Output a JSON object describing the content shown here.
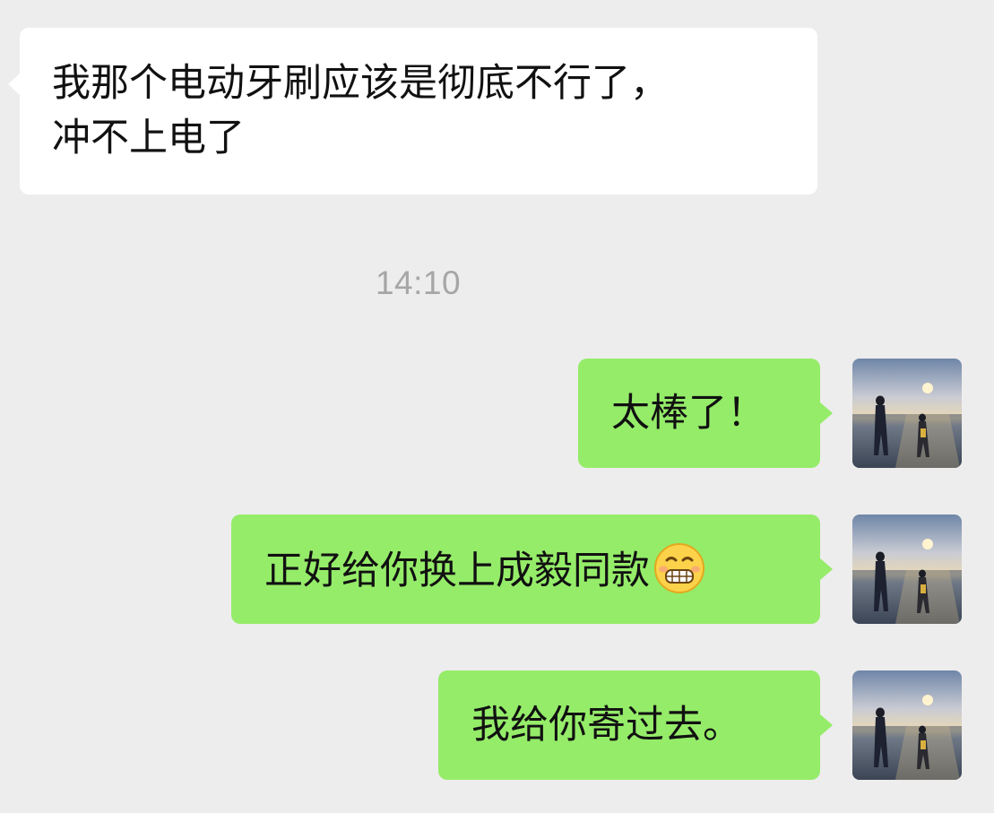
{
  "conversation": {
    "timestamp": "14:10",
    "messages": [
      {
        "direction": "incoming",
        "text": "我那个电动牙刷应该是彻底不行了，\n冲不上电了"
      },
      {
        "direction": "outgoing",
        "text": "太棒了！"
      },
      {
        "direction": "outgoing",
        "text": "正好给你换上成毅同款",
        "emoji": "grinning-face-emoji"
      },
      {
        "direction": "outgoing",
        "text": "我给你寄过去。"
      }
    ]
  },
  "avatar": {
    "icon": "avatar-sunset-beach-photo"
  },
  "colors": {
    "background": "#ededed",
    "incoming_bubble": "#ffffff",
    "outgoing_bubble": "#95ec69",
    "timestamp": "#a6a6a6",
    "text": "#111111"
  }
}
